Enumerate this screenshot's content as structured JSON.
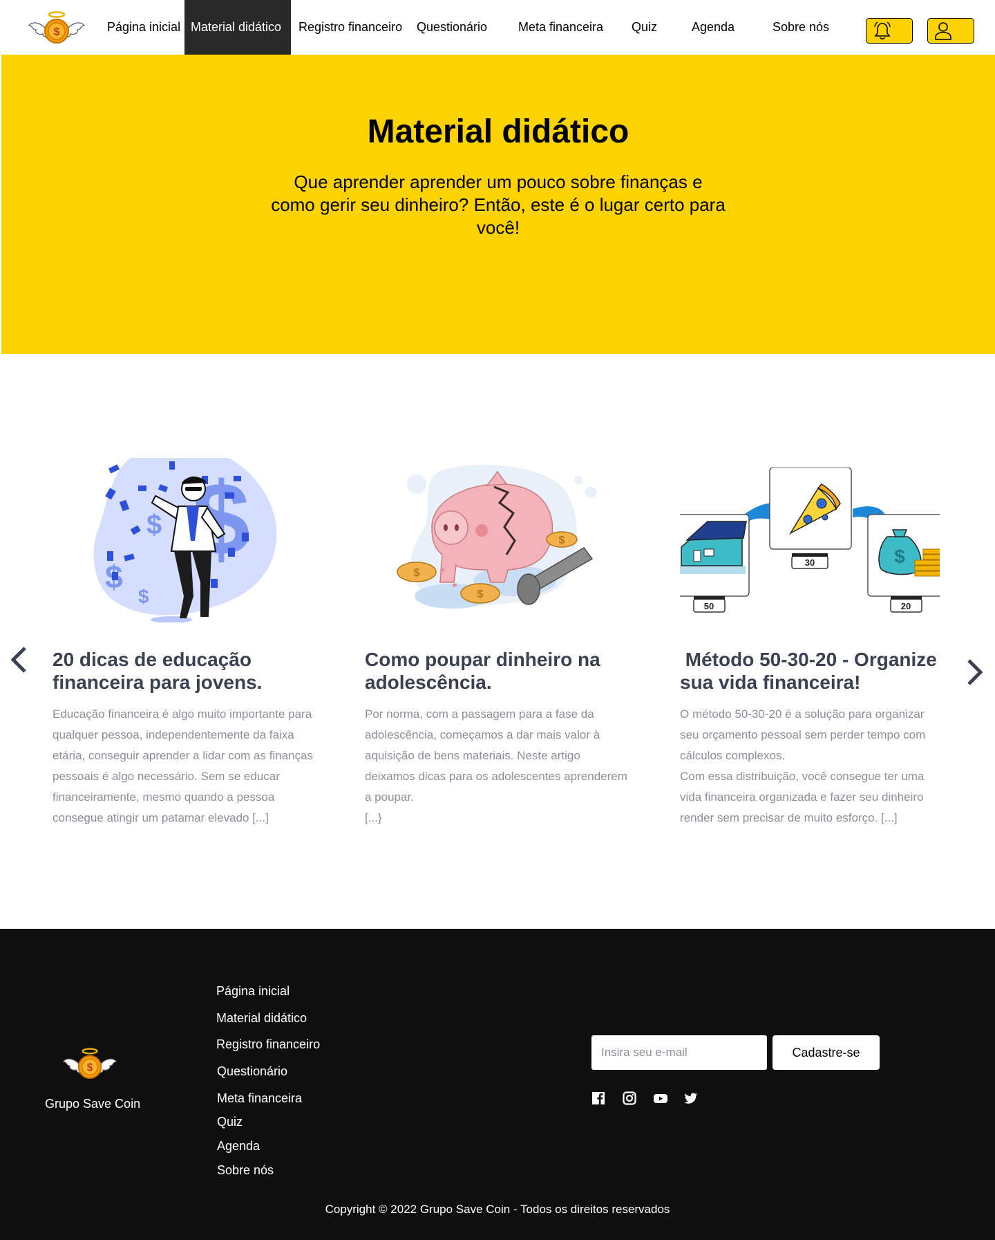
{
  "nav": {
    "items": [
      {
        "label": "Página inicial"
      },
      {
        "label": "Material didático"
      },
      {
        "label": "Registro financeiro"
      },
      {
        "label": "Questionário"
      },
      {
        "label": "Meta financeira"
      },
      {
        "label": "Quiz"
      },
      {
        "label": "Agenda"
      },
      {
        "label": "Sobre nós"
      }
    ],
    "active": "Material didático",
    "icons": [
      "bell-icon",
      "user-icon"
    ]
  },
  "hero": {
    "title": "Material didático",
    "subtitle": "Que aprender aprender um pouco sobre finanças e como gerir seu dinheiro? Então, este é o lugar certo para você!"
  },
  "cards": [
    {
      "title": "20 dicas de educação financeira para jovens.",
      "text": [
        "Educação financeira é algo muito importante para qualquer pessoa, independentemente da faixa etária, conseguir aprender a lidar com as finanças pessoais é algo necessário. Sem se educar financeiramente, mesmo quando a pessoa consegue atingir um patamar elevado [...]"
      ]
    },
    {
      "title": "Como poupar dinheiro na adolescência.",
      "text": [
        "Por norma, com a passagem para a fase da adolescência, começamos a dar mais valor à aquisição de bens materiais. Neste artigo deixamos dicas para os adolescentes aprenderem a poupar.",
        "[...}"
      ]
    },
    {
      "title": " Método 50-30-20 - Organize sua vida financeira!",
      "text": [
        "O método 50-30-20 é a solução para organizar seu orçamento pessoal sem perder tempo com cálculos complexos.",
        "Com essa distribuição, você consegue ter uma vida financeira organizada e fazer seu dinheiro render sem precisar de muito esforço. [...]"
      ],
      "image_labels": [
        "50",
        "30",
        "20"
      ]
    }
  ],
  "footer": {
    "brand": "Grupo Save Coin",
    "links": [
      "Página inicial",
      "Material didático",
      "Registro financeiro",
      "Questionário",
      "Meta financeira",
      "Quiz",
      "Agenda",
      "Sobre nós"
    ],
    "email_placeholder": "Insira seu e-mail",
    "signup_label": "Cadastre-se",
    "social": [
      "facebook-icon",
      "instagram-icon",
      "youtube-icon",
      "twitter-icon"
    ],
    "copyright": "Copyright © 2022 Grupo Save Coin - Todos os direitos reservados"
  },
  "colors": {
    "brand_yellow": "#FCD200",
    "nav_active_bg": "#292929",
    "footer_bg": "#0f0f0f",
    "card_title": "#3a4150",
    "card_text": "#8a8f99"
  }
}
